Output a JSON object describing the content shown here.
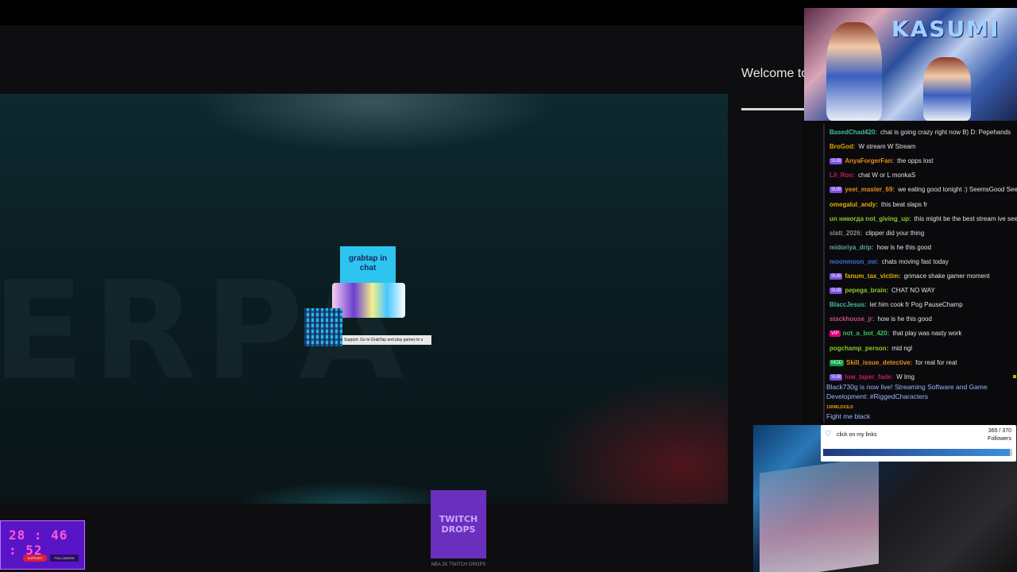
{
  "overlay": {
    "welcome_text": "Welcome to th",
    "banner_title": "KASUMI"
  },
  "grabtap": {
    "card_text": "grabtap in chat",
    "strip_text": "Support. Go to GrabTap and play games to s"
  },
  "drops": {
    "title": "TWITCH DROPS",
    "caption": "NBA 2K TWITCH DROPS"
  },
  "timer": {
    "digits": "28 : 46 : 52",
    "pill_left": "SUPPORT",
    "pill_right": "FOLLOWERS"
  },
  "chat": {
    "messages": [
      {
        "badge": "",
        "name": "BasedChad420:",
        "name_color": "#3fbfa0",
        "text": "chat is going crazy right now B) D: Pepehands"
      },
      {
        "badge": "",
        "name": "BroGod:",
        "name_color": "#e0a000",
        "text": "W stream W Stream"
      },
      {
        "badge": "SUB",
        "badge_color": "#7b4fe0",
        "name": "AnyaForgerFan:",
        "name_color": "#e88d1a",
        "text": "the opps lost"
      },
      {
        "badge": "",
        "name": "Lil_Ron:",
        "name_color": "#c02060",
        "text": "chat W or L monkaS"
      },
      {
        "badge": "SUB",
        "badge_color": "#7b4fe0",
        "name": "yeet_master_69:",
        "name_color": "#e88d1a",
        "text": "we eating good tonight :) SeemsGood Seem"
      },
      {
        "badge": "",
        "name": "omegalul_andy:",
        "name_color": "#e0b000",
        "text": "this beat slaps fr"
      },
      {
        "badge": "",
        "name": "un никогда not_giving_up:",
        "name_color": "#8ac926",
        "text": "this might be the best stream ive seen"
      },
      {
        "badge": "",
        "name": "slatt_2026:",
        "name_color": "#8a8a8a",
        "text": "clipper did your thing"
      },
      {
        "badge": "",
        "name": "midoriya_drip:",
        "name_color": "#5fa8a0",
        "text": "how is he this good"
      },
      {
        "badge": "",
        "name": "moonmoon_ow:",
        "name_color": "#3a70d0",
        "text": "chats moving fast today"
      },
      {
        "badge": "SUB",
        "badge_color": "#7b4fe0",
        "name": "fanum_tax_victim:",
        "name_color": "#e0b000",
        "text": "grimace shake gamer moment"
      },
      {
        "badge": "SUB",
        "badge_color": "#7b4fe0",
        "name": "pepega_brain:",
        "name_color": "#8ac926",
        "text": "CHAT NO WAY"
      },
      {
        "badge": "",
        "name": "BlaccJesus:",
        "name_color": "#3fbfa0",
        "text": "let him cook fr Pog PauseChamp"
      },
      {
        "badge": "",
        "name": "stackhouse_jr:",
        "name_color": "#c0507a",
        "text": "how is he this good"
      },
      {
        "badge": "VIP",
        "badge_color": "#e0007a",
        "name": "not_a_bot_420:",
        "name_color": "#3fbf60",
        "text": "that play was nasty work"
      },
      {
        "badge": "",
        "name": "pogchamp_person:",
        "name_color": "#8ac926",
        "text": "mid ngl"
      },
      {
        "badge": "MOD",
        "badge_color": "#00a040",
        "name": "Skill_issue_detective:",
        "name_color": "#e88d1a",
        "text": "for real for real"
      },
      {
        "badge": "SUB",
        "badge_color": "#7b4fe0",
        "name": "low_taper_fade:",
        "name_color": "#c02060",
        "text": "W lmg"
      }
    ],
    "notice": "Black730g is now live! Streaming Software and Game Development: #RiggedCharacters",
    "small_label": "130WILDX3LD",
    "fight_text": "Fight me black"
  },
  "follower_goal": {
    "label": "click on my links",
    "count": "365 / 370",
    "unit": "Followers",
    "progress": 0.986
  }
}
